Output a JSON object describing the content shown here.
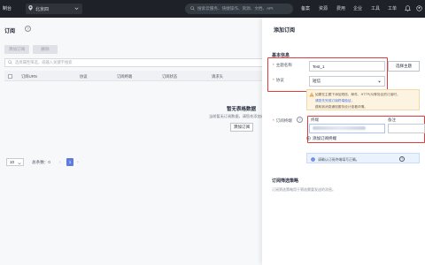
{
  "topbar": {
    "brand": "制台",
    "region": "北京四",
    "search_placeholder": "搜索云服务、快捷操作、资源、文档、API",
    "nav": [
      "备案",
      "资源",
      "费用",
      "企业",
      "工具",
      "工单"
    ]
  },
  "page": {
    "title": "订阅",
    "buttons": [
      "添加订阅",
      "删除"
    ],
    "filter_placeholder": "选择属性筛选，或输入关键字搜索",
    "columns": [
      "订阅URN",
      "协议",
      "订阅终端",
      "订阅状态",
      "请求头"
    ],
    "empty_title": "暂无表格数据",
    "empty_desc": "当前暂无订阅数据，请您先添加订阅",
    "empty_button": "添加订阅",
    "page_size": "10",
    "total": "总条数：0",
    "current_page": "1"
  },
  "panel": {
    "title": "添加订阅",
    "section_basic": "基本信息",
    "topic_label": "主题名称",
    "topic_value": "Test_1",
    "select_topic_button": "选择主题",
    "protocol_label": "协议",
    "protocol_value": "短信",
    "warning_lines": [
      "如果在主题下添加短信、邮件、HTTP(S)等协议的订阅时，",
      "请您先完成订阅终端验证，",
      "跳转到消息通知服务设计查看详情。"
    ],
    "endpoint_label": "订阅终端",
    "endpoint_col": "终端",
    "remark_col": "备注",
    "add_endpoint": "添加订阅终端",
    "info_text": "请确认订阅终端填写正确。",
    "section_filter": "订阅筛选策略",
    "filter_hint": "订阅筛选策略用于筛选需要发送的消息。"
  }
}
